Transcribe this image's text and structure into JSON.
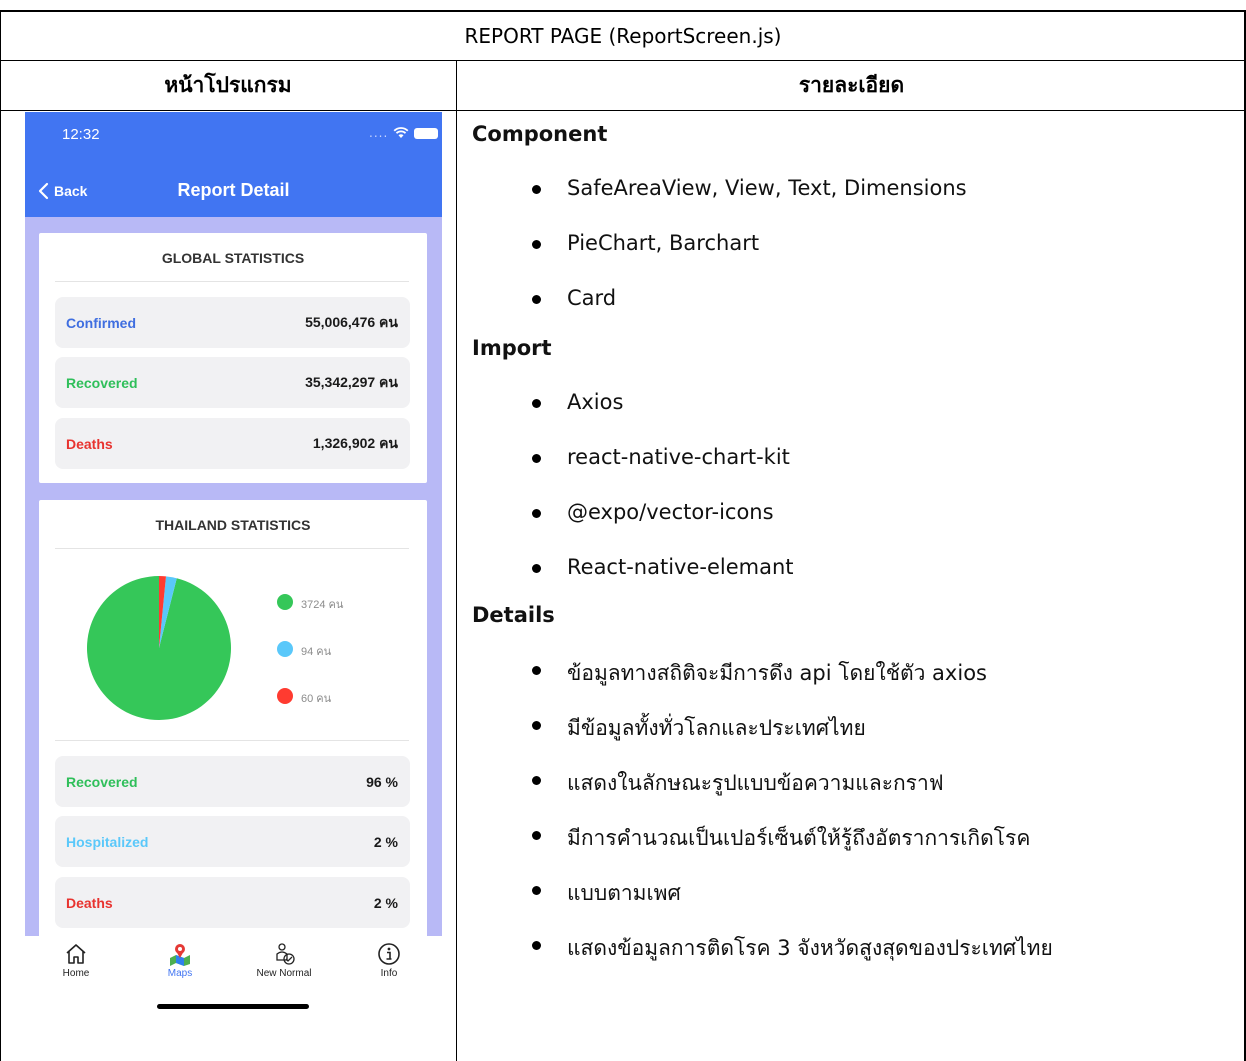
{
  "table": {
    "title": "REPORT PAGE (ReportScreen.js)",
    "col_left_header": "หน้าโปรแกรม",
    "col_right_header": "รายละเอียด"
  },
  "phone": {
    "status_time": "12:32",
    "status_dots": "....",
    "nav_back": "Back",
    "nav_title": "Report Detail",
    "global": {
      "title": "GLOBAL STATISTICS",
      "rows": [
        {
          "label": "Confirmed",
          "value": "55,006,476 คน",
          "color": "#3f6ee0"
        },
        {
          "label": "Recovered",
          "value": "35,342,297 คน",
          "color": "#2fbf5a"
        },
        {
          "label": "Deaths",
          "value": "1,326,902 คน",
          "color": "#e8332f"
        }
      ]
    },
    "thailand": {
      "title": "THAILAND STATISTICS",
      "legend": [
        {
          "text": "3724 คน",
          "color": "#35c759"
        },
        {
          "text": "94 คน",
          "color": "#5ac8fa"
        },
        {
          "text": "60 คน",
          "color": "#ff3b30"
        }
      ],
      "rows": [
        {
          "label": "Recovered",
          "value": "96 %",
          "color": "#2fbf5a"
        },
        {
          "label": "Hospitalized",
          "value": "2 %",
          "color": "#5ac8fa"
        },
        {
          "label": "Deaths",
          "value": "2 %",
          "color": "#e8332f"
        }
      ]
    },
    "tabs": [
      {
        "label": "Home",
        "icon": "home-icon"
      },
      {
        "label": "Maps",
        "icon": "map-icon"
      },
      {
        "label": "New Normal",
        "icon": "new-normal-icon"
      },
      {
        "label": "Info",
        "icon": "info-icon"
      }
    ]
  },
  "chart_data": {
    "type": "pie",
    "categories": [
      "Recovered",
      "Hospitalized",
      "Deaths"
    ],
    "values": [
      3724,
      94,
      60
    ],
    "legend_labels": [
      "3724 คน",
      "94 คน",
      "60 คน"
    ],
    "colors": [
      "#35c759",
      "#5ac8fa",
      "#ff3b30"
    ],
    "legend": "right"
  },
  "details": {
    "component_head": "Component",
    "component_items": [
      " SafeAreaView, View, Text, Dimensions",
      "PieChart, Barchart",
      "Card"
    ],
    "import_head": "Import",
    "import_items": [
      "Axios",
      "react-native-chart-kit",
      "@expo/vector-icons",
      "React-native-elemant"
    ],
    "details_head": "Details",
    "details_items": [
      "ข้อมูลทางสถิติจะมีการดึง api โดยใช้ตัว axios",
      "มีข้อมูลทั้งทั่วโลกและประเทศไทย",
      "แสดงในลักษณะรูปแบบข้อความและกราฟ",
      "มีการคำนวณเป็นเปอร์เซ็นต์ให้รู้ถึงอัตราการเกิดโรค",
      "แบบตามเพศ",
      "แสดงข้อมูลการติดโรค 3 จังหวัดสูงสุดของประเทศไทย"
    ]
  }
}
